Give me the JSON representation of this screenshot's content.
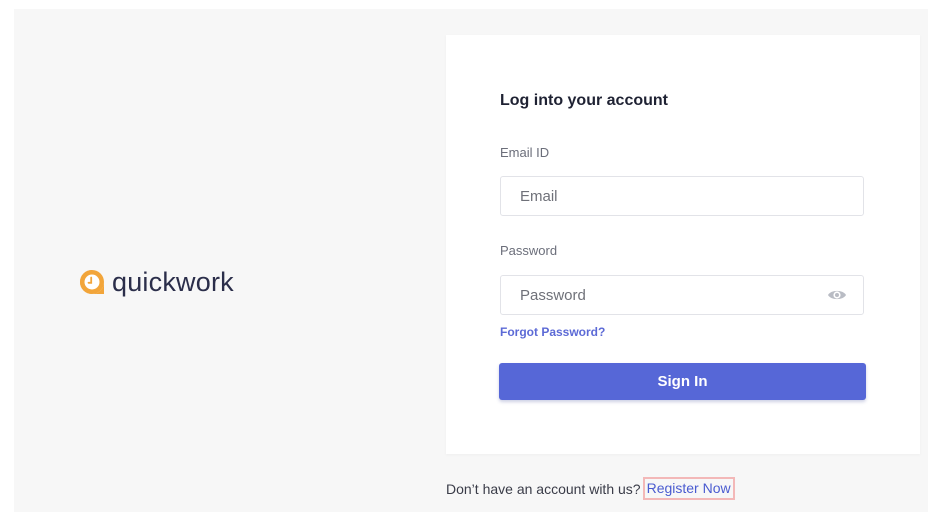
{
  "brand": {
    "name": "quickwork",
    "logo_color": "#f2a53a",
    "logo_icon": "clock-bubble-icon"
  },
  "login": {
    "title": "Log into your account",
    "email_label": "Email ID",
    "email_placeholder": "Email",
    "email_value": "",
    "password_label": "Password",
    "password_placeholder": "Password",
    "password_value": "",
    "password_toggle_icon": "eye-icon",
    "forgot_password": "Forgot Password?",
    "sign_in": "Sign In"
  },
  "register": {
    "prompt": "Don’t have an account with us?",
    "link": "Register Now"
  },
  "colors": {
    "accent": "#5667d7",
    "link": "#4a5bd0",
    "background": "#f7f7f7",
    "highlight_border": "#f3b8b8"
  }
}
